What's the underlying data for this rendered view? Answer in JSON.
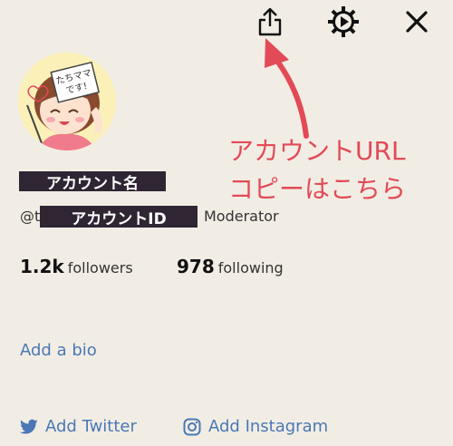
{
  "header": {
    "share_icon": "share-icon",
    "settings_icon": "gear-icon",
    "close_icon": "close-icon"
  },
  "avatar": {
    "sign_text": "たちママです!"
  },
  "profile": {
    "name_label": "アカウント名",
    "handle_prefix": "@t",
    "id_label": "アカウントID",
    "role": "Moderator"
  },
  "stats": {
    "followers_count": "1.2k",
    "followers_label": "followers",
    "following_count": "978",
    "following_label": "following"
  },
  "bio": {
    "add_label": "Add a bio"
  },
  "social": {
    "twitter_label": "Add Twitter",
    "instagram_label": "Add Instagram"
  },
  "annotation": {
    "text": "アカウントURL\nコピーはこちら",
    "color": "#e24a57"
  }
}
